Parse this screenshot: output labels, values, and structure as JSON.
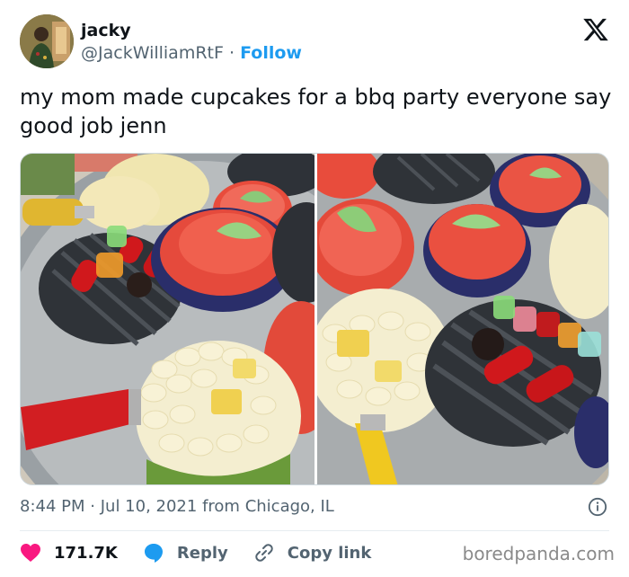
{
  "author": {
    "display_name": "jacky",
    "handle": "@JackWilliamRtF",
    "separator": "·",
    "follow_label": "Follow"
  },
  "tweet": {
    "text": "my mom made cupcakes for a bbq party everyone say good job jenn"
  },
  "meta": {
    "time": "8:44 PM",
    "dot": "·",
    "date": "Jul 10, 2021",
    "location": "from Chicago, IL"
  },
  "actions": {
    "likes_count": "171.7K",
    "reply_label": "Reply",
    "copy_link_label": "Copy link"
  },
  "watermark": "boredpanda.com",
  "icons": {
    "logo": "x-logo-icon",
    "info": "info-icon",
    "like": "heart-icon",
    "reply": "reply-bubble-icon",
    "copy": "link-icon"
  },
  "colors": {
    "accent": "#1d9bf0",
    "like": "#f91880",
    "text": "#0f1419",
    "secondary": "#536471"
  }
}
